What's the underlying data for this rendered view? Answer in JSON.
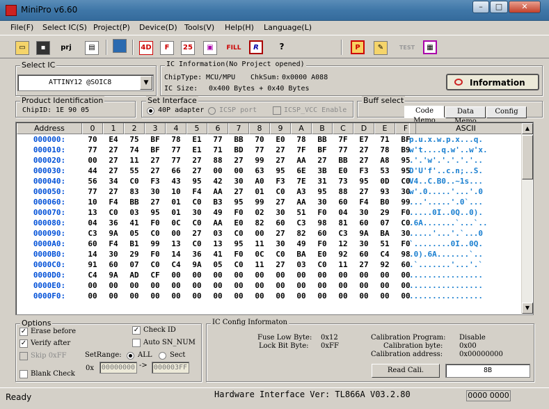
{
  "window": {
    "title": "MiniPro v6.60",
    "min": "–",
    "max": "□",
    "close": "✕"
  },
  "menu": [
    "File(F)",
    "Select IC(S)",
    "Project(P)",
    "Device(D)",
    "Tools(V)",
    "Help(H)",
    "Language(L)"
  ],
  "toolbar": {
    "open_icon": "folder-open-icon",
    "save_icon": "save-icon",
    "prj_label": "prj",
    "test_label": "TEST",
    "fill_label": "FILL",
    "help_label": "?"
  },
  "select_ic": {
    "title": "Select IC",
    "value": "ATTINY12  @SOIC8",
    "arrow": "▼"
  },
  "ic_info": {
    "title": "IC Information(No Project opened)",
    "chip_type_label": "ChipType:",
    "chip_type": "MCU/MPU",
    "checksum_label": "ChkSum:",
    "checksum": "0x0000 A088",
    "size_label": "IC Size:",
    "size": "0x400 Bytes + 0x40 Bytes",
    "info_button": "Information"
  },
  "product": {
    "title": "Product Identification",
    "chip_id_label": "ChipID:",
    "chip_id": "1E 90 05"
  },
  "interface": {
    "title": "Set Interface",
    "opt1": "40P adapter",
    "opt2": "ICSP port",
    "opt3": "ICSP_VCC Enable"
  },
  "buff": {
    "title": "Buff select",
    "tabs": [
      "Code Memo",
      "Data Memo",
      "Config"
    ]
  },
  "hex": {
    "headers": [
      "Address",
      "0",
      "1",
      "2",
      "3",
      "4",
      "5",
      "6",
      "7",
      "8",
      "9",
      "A",
      "B",
      "C",
      "D",
      "E",
      "F",
      "ASCII"
    ],
    "rows": [
      {
        "addr": "000000:",
        "bytes": [
          "70",
          "E4",
          "75",
          "BF",
          "78",
          "E1",
          "77",
          "BB",
          "70",
          "E0",
          "78",
          "BB",
          "7F",
          "E7",
          "71",
          "BF"
        ],
        "ascii": "p.u.x.w.p.x...q."
      },
      {
        "addr": "000010:",
        "bytes": [
          "77",
          "27",
          "74",
          "BF",
          "77",
          "E1",
          "71",
          "BD",
          "77",
          "27",
          "7F",
          "BF",
          "77",
          "27",
          "78",
          "B9"
        ],
        "ascii": "w't....q.w'..w'x."
      },
      {
        "addr": "000020:",
        "bytes": [
          "00",
          "27",
          "11",
          "27",
          "77",
          "27",
          "88",
          "27",
          "99",
          "27",
          "AA",
          "27",
          "BB",
          "27",
          "A8",
          "95"
        ],
        "ascii": ".'.'w'.'.'.'.'.."
      },
      {
        "addr": "000030:",
        "bytes": [
          "44",
          "27",
          "55",
          "27",
          "66",
          "27",
          "00",
          "00",
          "63",
          "95",
          "6E",
          "3B",
          "E0",
          "F3",
          "53",
          "95"
        ],
        "ascii": "D'U'f'..c.n;..S."
      },
      {
        "addr": "000040:",
        "bytes": [
          "56",
          "34",
          "C0",
          "F3",
          "43",
          "95",
          "42",
          "30",
          "A0",
          "F3",
          "7E",
          "31",
          "73",
          "95",
          "0D",
          "C0"
        ],
        "ascii": "V4..C.B0..~1s..."
      },
      {
        "addr": "000050:",
        "bytes": [
          "77",
          "27",
          "83",
          "30",
          "10",
          "F4",
          "AA",
          "27",
          "01",
          "C0",
          "A3",
          "95",
          "88",
          "27",
          "93",
          "30"
        ],
        "ascii": "w'.0.....'...'.0"
      },
      {
        "addr": "000060:",
        "bytes": [
          "10",
          "F4",
          "BB",
          "27",
          "01",
          "C0",
          "B3",
          "95",
          "99",
          "27",
          "AA",
          "30",
          "60",
          "F4",
          "B0",
          "99"
        ],
        "ascii": "...'.....'.0`..."
      },
      {
        "addr": "000070:",
        "bytes": [
          "13",
          "C0",
          "03",
          "95",
          "01",
          "30",
          "49",
          "F0",
          "02",
          "30",
          "51",
          "F0",
          "04",
          "30",
          "29",
          "F0"
        ],
        "ascii": ".....0I..0Q..0)."
      },
      {
        "addr": "000080:",
        "bytes": [
          "04",
          "36",
          "41",
          "F0",
          "0C",
          "C0",
          "AA",
          "E0",
          "82",
          "60",
          "C3",
          "98",
          "81",
          "60",
          "07",
          "C0"
        ],
        "ascii": ".6A.......`...`.."
      },
      {
        "addr": "000090:",
        "bytes": [
          "C3",
          "9A",
          "05",
          "C0",
          "00",
          "27",
          "03",
          "C0",
          "00",
          "27",
          "82",
          "60",
          "C3",
          "9A",
          "BA",
          "30"
        ],
        "ascii": ".....'...'.`...0"
      },
      {
        "addr": "0000A0:",
        "bytes": [
          "60",
          "F4",
          "B1",
          "99",
          "13",
          "C0",
          "13",
          "95",
          "11",
          "30",
          "49",
          "F0",
          "12",
          "30",
          "51",
          "F0"
        ],
        "ascii": "`........0I..0Q."
      },
      {
        "addr": "0000B0:",
        "bytes": [
          "14",
          "30",
          "29",
          "F0",
          "14",
          "36",
          "41",
          "F0",
          "0C",
          "C0",
          "BA",
          "E0",
          "92",
          "60",
          "C4",
          "98"
        ],
        "ascii": ".0).6A.......`.."
      },
      {
        "addr": "0000C0:",
        "bytes": [
          "91",
          "60",
          "07",
          "C0",
          "C4",
          "9A",
          "05",
          "C0",
          "11",
          "27",
          "03",
          "C0",
          "11",
          "27",
          "92",
          "60"
        ],
        "ascii": ".`.......'...'.`"
      },
      {
        "addr": "0000D0:",
        "bytes": [
          "C4",
          "9A",
          "AD",
          "CF",
          "00",
          "00",
          "00",
          "00",
          "00",
          "00",
          "00",
          "00",
          "00",
          "00",
          "00",
          "00"
        ],
        "ascii": "................"
      },
      {
        "addr": "0000E0:",
        "bytes": [
          "00",
          "00",
          "00",
          "00",
          "00",
          "00",
          "00",
          "00",
          "00",
          "00",
          "00",
          "00",
          "00",
          "00",
          "00",
          "00"
        ],
        "ascii": "................"
      },
      {
        "addr": "0000F0:",
        "bytes": [
          "00",
          "00",
          "00",
          "00",
          "00",
          "00",
          "00",
          "00",
          "00",
          "00",
          "00",
          "00",
          "00",
          "00",
          "00",
          "00"
        ],
        "ascii": "................"
      }
    ]
  },
  "options": {
    "title": "Options",
    "erase": "Erase before",
    "verify": "Verify after",
    "skip": "Skip 0xFF",
    "blank": "Blank Check",
    "check_id": "Check ID",
    "auto_sn": "Auto SN_NUM",
    "setrange": "SetRange:",
    "all": "ALL",
    "sect": "Sect",
    "ox": "0x",
    "from": "00000000",
    "arrow": "->",
    "to": "000003FF"
  },
  "config": {
    "title": "IC Config Informaton",
    "fuse_low_label": "Fuse Low Byte:",
    "fuse_low": "0x12",
    "lock_label": "Lock Bit Byte:",
    "lock": "0xFF",
    "cal_prog_label": "Calibration Program:",
    "cal_prog": "Disable",
    "cal_byte_label": "Calibration byte:",
    "cal_byte": "0x00",
    "cal_addr_label": "Calibration address:",
    "cal_addr": "0x00000000",
    "read_cali": "Read Cali.",
    "cali_value": "8B"
  },
  "status": {
    "ready": "Ready",
    "hw": "Hardware Interface Ver: TL866A V03.2.80",
    "counter": "0000 0000"
  }
}
